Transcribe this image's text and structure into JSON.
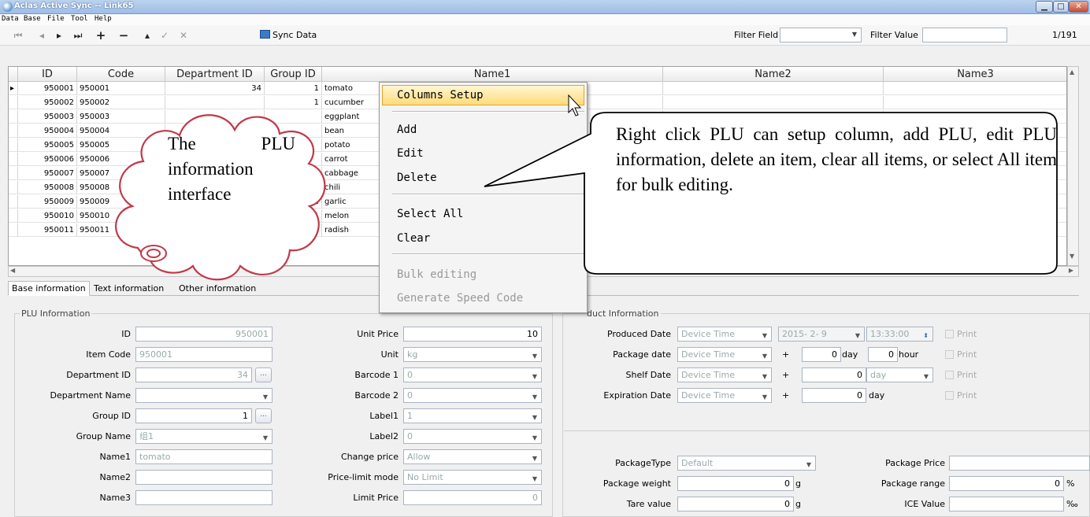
{
  "window": {
    "title": "Aclas Active Sync -- Link65"
  },
  "menubar": [
    "Data",
    "Base",
    "File",
    "Tool",
    "Help"
  ],
  "toolbar": {
    "sync_label": "Sync Data",
    "filter_field_label": "Filter Field",
    "filter_value_label": "Filter Value",
    "filter_field_value": "",
    "filter_value_value": "",
    "page_indicator": "1/191"
  },
  "grid": {
    "columns": [
      "ID",
      "Code",
      "Department ID",
      "Group ID",
      "Name1",
      "Name2",
      "Name3"
    ],
    "rows": [
      {
        "id": "950001",
        "code": "950001",
        "dept": "34",
        "group": "1",
        "name1": "tomato"
      },
      {
        "id": "950002",
        "code": "950002",
        "dept": "",
        "group": "1",
        "name1": "cucumber"
      },
      {
        "id": "950003",
        "code": "950003",
        "dept": "",
        "group": "",
        "name1": "eggplant"
      },
      {
        "id": "950004",
        "code": "950004",
        "dept": "",
        "group": "",
        "name1": "bean"
      },
      {
        "id": "950005",
        "code": "950005",
        "dept": "",
        "group": "",
        "name1": "potato"
      },
      {
        "id": "950006",
        "code": "950006",
        "dept": "",
        "group": "",
        "name1": "carrot"
      },
      {
        "id": "950007",
        "code": "950007",
        "dept": "",
        "group": "",
        "name1": "cabbage"
      },
      {
        "id": "950008",
        "code": "950008",
        "dept": "",
        "group": "",
        "name1": "chili"
      },
      {
        "id": "950009",
        "code": "950009",
        "dept": "",
        "group": "1",
        "name1": "garlic"
      },
      {
        "id": "950010",
        "code": "950010",
        "dept": "",
        "group": "1",
        "name1": "melon"
      },
      {
        "id": "950011",
        "code": "950011",
        "dept": "",
        "group": "1",
        "name1": "radish"
      }
    ]
  },
  "context_menu": {
    "items": [
      "Columns Setup",
      "Add",
      "Edit",
      "Delete",
      "Select All",
      "Clear",
      "Bulk editing",
      "Generate Speed Code"
    ]
  },
  "annotations": {
    "cloud": "The PLU information interface",
    "callout": "Right click PLU can setup column, add PLU, edit PLU information, delete an item, clear all items, or select All item for bulk editing."
  },
  "tabs": [
    "Base information",
    "Text information",
    "Other information"
  ],
  "plu_info": {
    "legend": "PLU Information",
    "fields": {
      "id_label": "ID",
      "id": "950001",
      "item_code_label": "Item Code",
      "item_code": "950001",
      "dept_id_label": "Department ID",
      "dept_id": "34",
      "dept_name_label": "Department Name",
      "dept_name": "",
      "group_id_label": "Group ID",
      "group_id": "1",
      "group_name_label": "Group Name",
      "group_name": "组1",
      "name1_label": "Name1",
      "name1": "tomato",
      "name2_label": "Name2",
      "name2": "",
      "name3_label": "Name3",
      "name3": "",
      "unit_price_label": "Unit Price",
      "unit_price": "10",
      "unit_label": "Unit",
      "unit": "kg",
      "barcode1_label": "Barcode 1",
      "barcode1": "0",
      "barcode2_label": "Barcode 2",
      "barcode2": "0",
      "label1_label": "Label1",
      "label1": "1",
      "label2_label": "Label2",
      "label2": "0",
      "change_price_label": "Change price",
      "change_price": "Allow",
      "price_limit_label": "Price-limit mode",
      "price_limit": "No Limit",
      "limit_price_label": "Limit Price",
      "limit_price": "0"
    }
  },
  "product_info": {
    "legend": "duct Information",
    "produced_label": "Produced Date",
    "produced_mode": "Device Time",
    "produced_date": "2015- 2- 9",
    "produced_time": "13:33:00",
    "package_label": "Package date",
    "package_mode": "Device Time",
    "package_days": "0",
    "package_hours": "0",
    "shelf_label": "Shelf Date",
    "shelf_mode": "Device Time",
    "shelf_value": "0",
    "shelf_unit": "day",
    "expiration_label": "Expiration Date",
    "expiration_mode": "Device Time",
    "expiration_value": "0",
    "day_unit": "day",
    "hour_unit": "hour",
    "plus": "+",
    "print": "Print",
    "package_type_label": "PackageType",
    "package_type": "Default",
    "package_price_label": "Package Price",
    "package_price": "",
    "package_weight_label": "Package weight",
    "package_weight": "0",
    "g_unit": "g",
    "package_range_label": "Package range",
    "package_range": "0",
    "percent": "%",
    "tare_label": "Tare value",
    "tare": "0",
    "ice_label": "ICE Value",
    "ice": "",
    "permille": "‰"
  }
}
